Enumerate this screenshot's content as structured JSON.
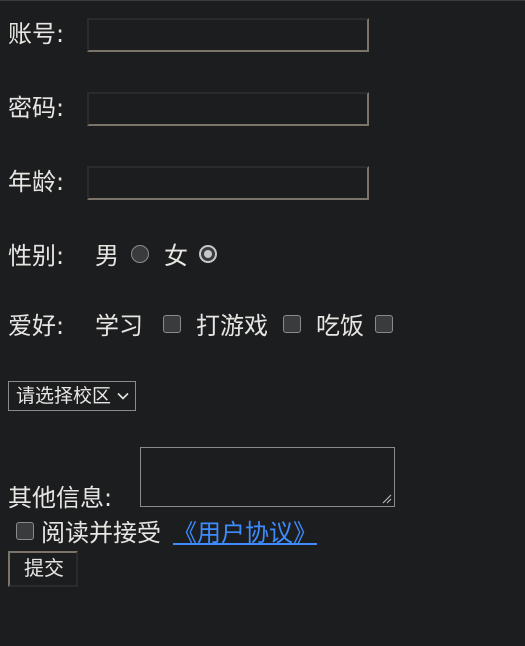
{
  "form": {
    "account_label": "账号:",
    "account_value": "",
    "password_label": "密码:",
    "password_value": "",
    "age_label": "年龄:",
    "age_value": "",
    "gender_label": "性别:",
    "gender_options": [
      {
        "label": "男",
        "checked": false
      },
      {
        "label": "女",
        "checked": true
      }
    ],
    "hobby_label": "爱好:",
    "hobby_options": [
      {
        "label": "学习",
        "checked": false
      },
      {
        "label": "打游戏",
        "checked": false
      },
      {
        "label": "吃饭",
        "checked": false
      }
    ],
    "campus_select_value": "请选择校区",
    "other_info_label": "其他信息:",
    "other_info_value": "",
    "agree_text": "阅读并接受",
    "agree_link": "《用户协议》",
    "agree_checked": false,
    "submit_label": "提交"
  },
  "colors": {
    "background": "#1c1d1f",
    "text": "#e8e6e3",
    "link": "#3d8bfd"
  }
}
